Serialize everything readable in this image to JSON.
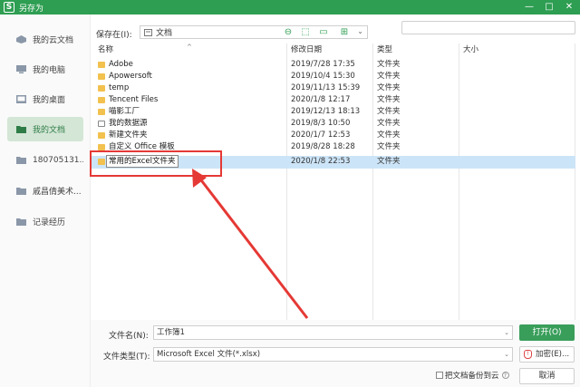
{
  "titlebar": {
    "title": "另存为",
    "app_logo": "S",
    "min_glyph": "—",
    "max_glyph": "□",
    "close_glyph": "✕"
  },
  "sidebar": {
    "items": [
      {
        "label": "我的云文档",
        "icon": "cloud-doc-icon"
      },
      {
        "label": "我的电脑",
        "icon": "computer-icon"
      },
      {
        "label": "我的桌面",
        "icon": "desktop-icon"
      },
      {
        "label": "我的文档",
        "icon": "folder-icon",
        "active": true
      },
      {
        "label": "180705131...",
        "icon": "folder-icon"
      },
      {
        "label": "戚昌倩美术...",
        "icon": "folder-icon"
      },
      {
        "label": "记录经历",
        "icon": "folder-icon"
      }
    ]
  },
  "toolbar": {
    "save_in_label": "保存在(I):",
    "location": "文档",
    "search_placeholder": ""
  },
  "columns": {
    "name": "名称",
    "date": "修改日期",
    "type": "类型",
    "size": "大小"
  },
  "files": [
    {
      "name": "Adobe",
      "date": "2019/7/28 17:35",
      "type": "文件夹"
    },
    {
      "name": "Apowersoft",
      "date": "2019/10/4 15:30",
      "type": "文件夹"
    },
    {
      "name": "temp",
      "date": "2019/11/13 15:39",
      "type": "文件夹"
    },
    {
      "name": "Tencent Files",
      "date": "2020/1/8 12:17",
      "type": "文件夹"
    },
    {
      "name": "喵影工厂",
      "date": "2019/12/13 18:13",
      "type": "文件夹"
    },
    {
      "name": "我的数据源",
      "date": "2019/8/3 10:50",
      "type": "文件夹"
    },
    {
      "name": "新建文件夹",
      "date": "2020/1/7 12:53",
      "type": "文件夹"
    },
    {
      "name": "自定义 Office 模板",
      "date": "2019/8/28 18:28",
      "type": "文件夹"
    },
    {
      "name": "常用的Excel文件夹",
      "date": "2020/1/8 22:53",
      "type": "文件夹",
      "selected": true,
      "editing": true
    }
  ],
  "bottom": {
    "filename_label": "文件名(N):",
    "filename_value": "工作簿1",
    "filetype_label": "文件类型(T):",
    "filetype_value": "Microsoft Excel 文件(*.xlsx)",
    "open_button": "打开(O)",
    "encrypt_button": "加密(E)...",
    "cancel_button": "取消",
    "backup_label": "把文档备份到云"
  },
  "colors": {
    "accent": "#2e9e52",
    "annotation": "#e53935",
    "selection": "#cce4f7"
  }
}
